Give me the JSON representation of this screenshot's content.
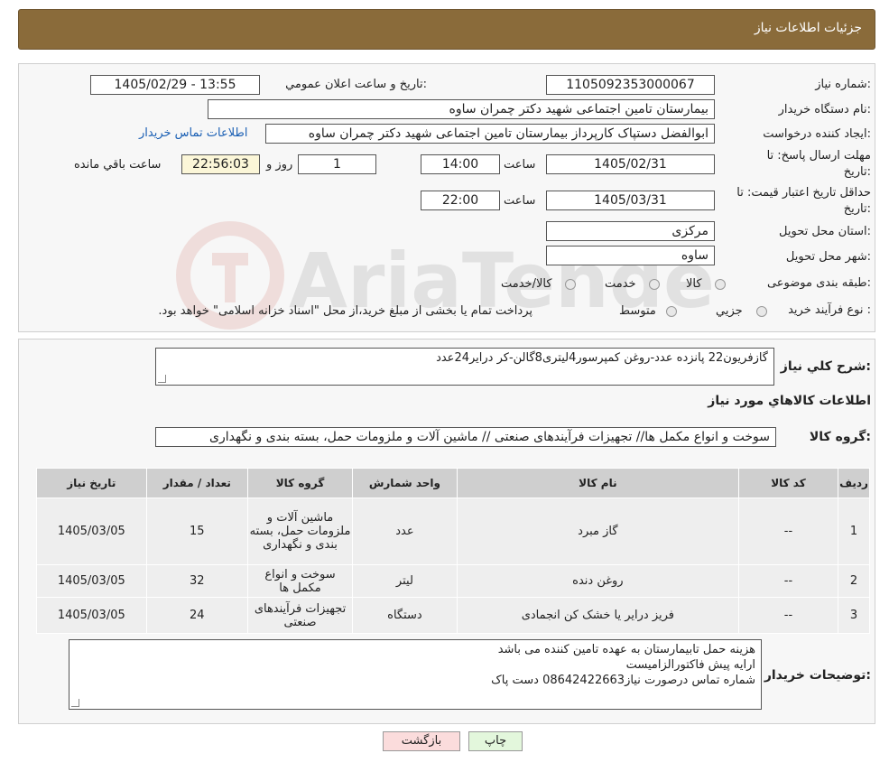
{
  "header": {
    "title": "جزئیات اطلاعات نیاز"
  },
  "need_number": {
    "label": "شماره نیاز:",
    "value": "1105092353000067"
  },
  "announce": {
    "label": "تاریخ و ساعت اعلان عمومي:",
    "value": "1405/02/29 - 13:55"
  },
  "buyer_org": {
    "label": "نام دستگاه خريدار:",
    "value": "بیمارستان تامین اجتماعی شهید دکتر چمران ساوه"
  },
  "requester": {
    "label": "ايجاد کننده درخواست:",
    "value": "ابوالفضل  دستپاک  کارپرداز بیمارستان تامین اجتماعی شهید دکتر چمران ساوه",
    "contact_link": "اطلاعات تماس خريدار"
  },
  "deadline": {
    "label_line1": "مهلت ارسال پاسخ: تا",
    "label_line2": "تاريخ:",
    "date": "1405/02/31",
    "time_label": "ساعت",
    "time": "14:00",
    "days": "1",
    "days_label": "روز و",
    "remaining": "22:56:03",
    "remaining_label": "ساعت باقي مانده"
  },
  "validity": {
    "label_line1": "حداقل تاريخ اعتبار قيمت: تا",
    "label_line2": "تاريخ:",
    "date": "1405/03/31",
    "time_label": "ساعت",
    "time": "22:00"
  },
  "province": {
    "label": "استان محل تحويل:",
    "value": "مرکزی"
  },
  "city": {
    "label": "شهر محل تحويل:",
    "value": "ساوه"
  },
  "category": {
    "label": "طبقه بندی موضوعی:",
    "options": [
      "کالا",
      "خدمت",
      "کالا/خدمت"
    ]
  },
  "process": {
    "label": "نوع فرآيند خريد :",
    "options": [
      "جزيي",
      "متوسط"
    ],
    "note": "پرداخت تمام يا بخشی از مبلغ خريد،از محل \"اسناد خزانه اسلامی\" خواهد بود."
  },
  "description": {
    "label": "شرح کلي نياز:",
    "value": "گازفریون22 پانزده عدد-روغن کمپرسور4لیتری8گالن-کر درایر24عدد"
  },
  "items_title": "اطلاعات کالاهاي مورد نياز",
  "goods_group": {
    "label": "گروه کالا:",
    "value": "سوخت و انواع مکمل ها// تجهیزات فرآیندهای صنعتی // ماشین آلات و ملزومات حمل، بسته بندی و نگهداری"
  },
  "table": {
    "headers": [
      "رديف",
      "کد کالا",
      "نام کالا",
      "واحد شمارش",
      "گروه کالا",
      "تعداد / مقدار",
      "تاريخ نياز"
    ],
    "rows": [
      [
        "1",
        "--",
        "گاز مبرد",
        "عدد",
        "ماشین آلات و ملزومات حمل، بسته بندی و نگهداری",
        "15",
        "1405/03/05"
      ],
      [
        "2",
        "--",
        "روغن دنده",
        "لیتر",
        "سوخت و انواع مکمل ها",
        "32",
        "1405/03/05"
      ],
      [
        "3",
        "--",
        "فریز درایر یا خشک کن انجمادی",
        "دستگاه",
        "تجهیزات فرآیندهای صنعتی",
        "24",
        "1405/03/05"
      ]
    ]
  },
  "buyer_notes": {
    "label": "توضيحات خريدار:",
    "lines": [
      "هزینه حمل تابیمارستان به عهده تامین کننده می باشد",
      "ارایه پیش فاکتورالزامیست",
      "شماره تماس درصورت نیاز08642422663 دست پاک"
    ]
  },
  "buttons": {
    "print": "چاپ",
    "back": "بازگشت"
  },
  "watermark": "AriaTender.neT",
  "colors": {
    "header_bg": "#8a6b3a",
    "back_button_bg": "#fbdcdc",
    "print_button_bg": "#e3f7dc",
    "remaining_bg": "#fbf6d8"
  }
}
